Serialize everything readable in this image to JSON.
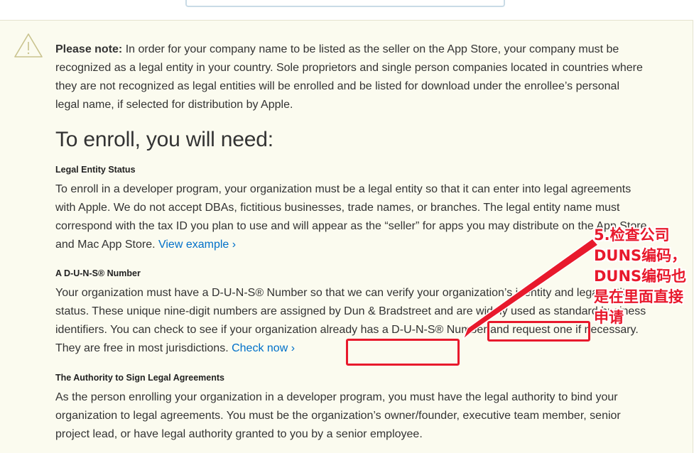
{
  "note": {
    "label": "Please note:",
    "text": " In order for your company name to be listed as the seller on the App Store, your company must be recognized as a legal entity in your country. Sole proprietors and single person companies located in countries where they are not recognized as legal entities will be enrolled and be listed for download under the enrollee’s personal legal name, if selected for distribution by Apple."
  },
  "heading": "To enroll, you will need:",
  "sections": [
    {
      "title": "Legal Entity Status",
      "body": "To enroll in a developer program, your organization must be a legal entity so that it can enter into legal agreements with Apple. We do not accept DBAs, fictitious businesses, trade names, or branches. The legal entity name must correspond with the tax ID you plan to use and will appear as the “seller” for apps you may distribute on the App Store and Mac App Store. ",
      "link": "View example ›"
    },
    {
      "title": "A D-U-N-S® Number",
      "body": "Your organization must have a D-U-N-S® Number so that we can verify your organization’s identity and legal entity status. These unique nine-digit numbers are assigned by Dun & Bradstreet and are widely used as standard business identifiers. You can check to see if your organization already has a D-U-N-S® Number and request one if necessary. They are free in most jurisdictions. ",
      "link": "Check now ›"
    },
    {
      "title": "The Authority to Sign Legal Agreements",
      "body": "As the person enrolling your organization in a developer program, you must have the legal authority to bind your organization to legal agreements. You must be the organization’s owner/founder, executive team member, senior project lead, or have legal authority granted to you by a senior employee."
    }
  ],
  "annotation": {
    "text": "5.检查公司\nDUNS编码，\nDUNS编码也\n是在里面直接\n申请",
    "color": "#e8192c"
  },
  "icons": {
    "warning": "warning-triangle-icon"
  },
  "colors": {
    "link": "#0070c9",
    "panel": "#fbfbef",
    "annotation": "#e8192c"
  }
}
